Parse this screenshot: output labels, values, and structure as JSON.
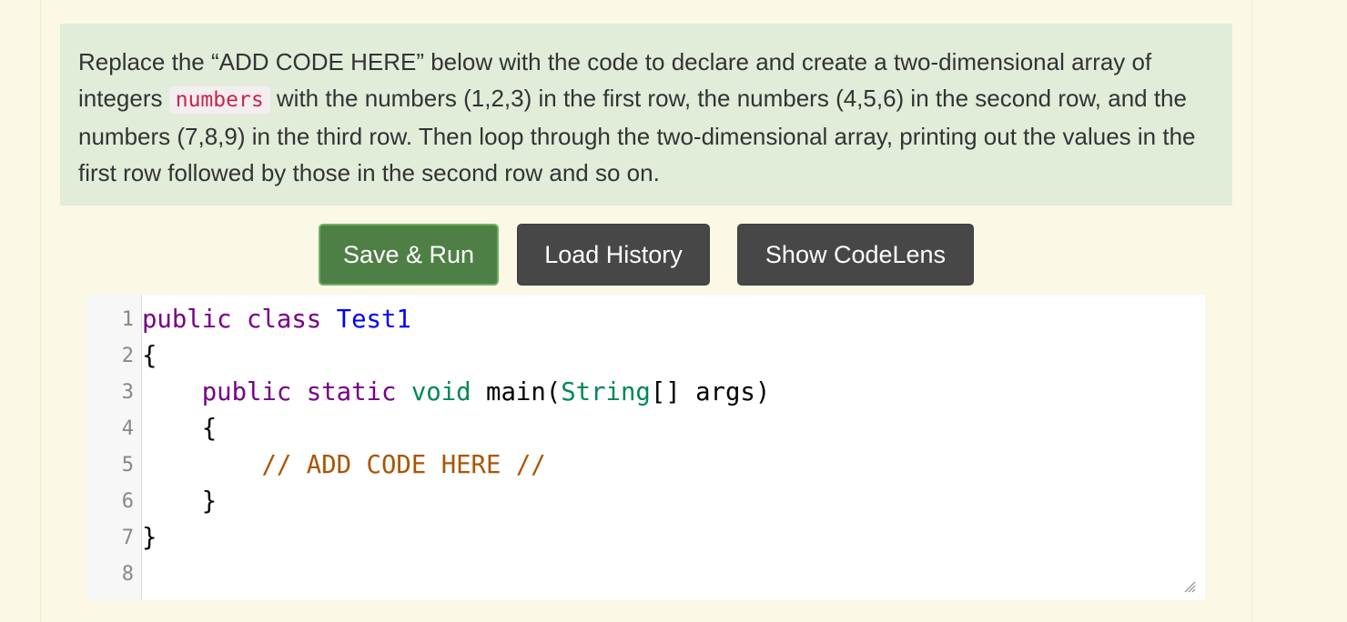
{
  "instructions": {
    "text_before": "Replace the “ADD CODE HERE” below with the code to declare and create a two-dimensional array of integers",
    "code_term": "numbers",
    "text_after": "with the numbers (1,2,3) in the first row, the numbers (4,5,6) in the second row, and the numbers (7,8,9) in the third row. Then loop through the two-dimensional array, printing out the values in the first row followed by those in the second row and so on."
  },
  "buttons": {
    "save_run": "Save & Run",
    "load_history": "Load History",
    "show_codelens": "Show CodeLens"
  },
  "editor": {
    "line_numbers": [
      "1",
      "2",
      "3",
      "4",
      "5",
      "6",
      "7",
      "8"
    ],
    "lines": [
      {
        "indent": "",
        "kw1": "public",
        "kw2": "class",
        "name": "Test1"
      },
      {
        "text": "{"
      },
      {
        "indent": "    ",
        "kw1": "public",
        "kw2": "static",
        "type": "void",
        "rest": "main(",
        "type2": "String",
        "rest2": "[] args)"
      },
      {
        "text": "    {"
      },
      {
        "indent": "        ",
        "comment": "// ADD CODE HERE //"
      },
      {
        "text": "    }"
      },
      {
        "text": "}"
      },
      {
        "text": ""
      }
    ]
  },
  "icons": {
    "resize": "resize-handle-icon"
  }
}
